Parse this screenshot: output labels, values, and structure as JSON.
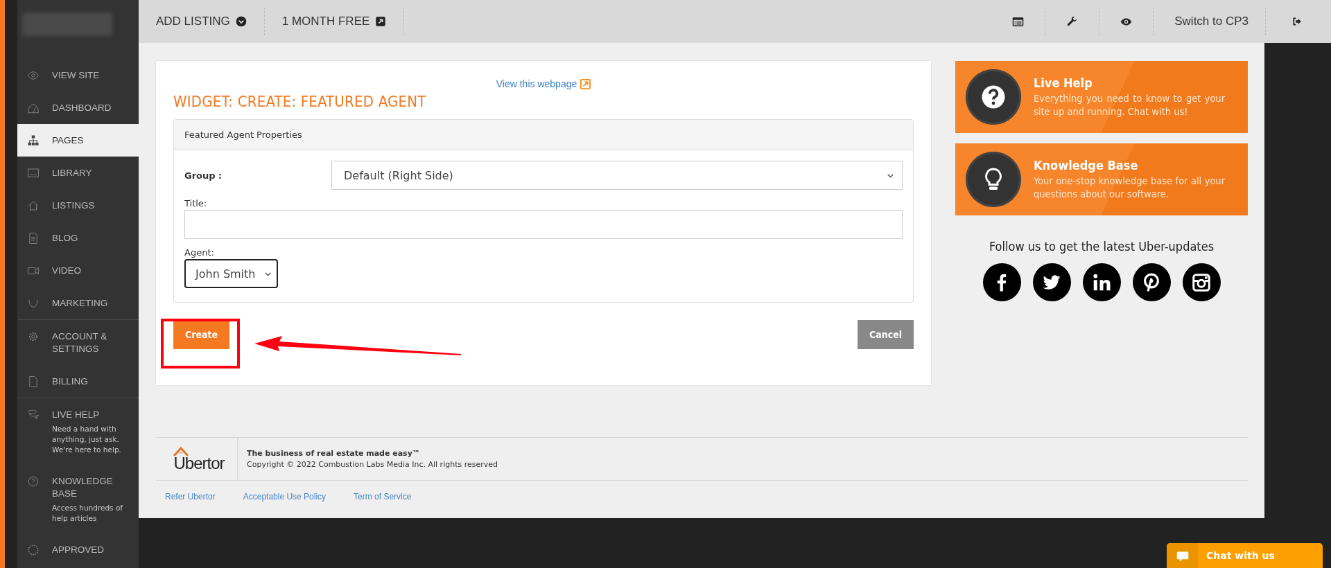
{
  "sidebar": {
    "sections": [
      {
        "items": [
          {
            "label": "VIEW SITE",
            "selected": false
          },
          {
            "label": "DASHBOARD",
            "selected": false
          },
          {
            "label": "PAGES",
            "selected": true
          },
          {
            "label": "LIBRARY",
            "selected": false
          },
          {
            "label": "LISTINGS",
            "selected": false
          },
          {
            "label": "BLOG",
            "selected": false
          },
          {
            "label": "VIDEO",
            "selected": false
          },
          {
            "label": "MARKETING",
            "selected": false
          }
        ]
      },
      {
        "items": [
          {
            "label": "ACCOUNT & SETTINGS",
            "selected": false
          },
          {
            "label": "BILLING",
            "selected": false
          }
        ]
      },
      {
        "items": [
          {
            "label": "LIVE HELP",
            "description": "Need a hand with anything, just ask. We're here to help.",
            "selected": false
          },
          {
            "label": "KNOWLEDGE BASE",
            "description": "Access hundreds of help articles",
            "selected": false
          },
          {
            "label": "APPROVED",
            "selected": false
          }
        ]
      }
    ]
  },
  "topbar": {
    "left": [
      {
        "label": "ADD LISTING",
        "kind": "dropdown"
      },
      {
        "label": "1 MONTH FREE",
        "kind": "external"
      }
    ],
    "switch_label": "Switch to CP3"
  },
  "form": {
    "link": "View this webpage",
    "title": "WIDGET: CREATE: FEATURED AGENT",
    "panel_title": "Featured Agent Properties",
    "group_label": "Group :",
    "group_value": "Default (Right Side)",
    "title_label": "Title:",
    "agent_label": "Agent:",
    "agent_value": "John Smith",
    "buttons": [
      {
        "label": "Create",
        "kind": "primary"
      },
      {
        "label": "Cancel",
        "kind": "secondary"
      }
    ]
  },
  "help_cards": [
    {
      "title": "Live Help",
      "text": "Everything you need to know to get your site up and running. Chat with us!",
      "kind": "question"
    },
    {
      "title": "Knowledge Base",
      "text": "Your one-stop knowledge base for all your questions about our software.",
      "kind": "bulb"
    }
  ],
  "follow_text": "Follow us to get the latest Uber-updates",
  "footer": {
    "logo": "Ubertor",
    "tagline": "The business of real estate made easy™",
    "copyright": "Copyright © 2022 Combustion Labs Media Inc. All rights reserved",
    "links": [
      "Refer Ubertor",
      "Acceptable Use Policy",
      "Term of Service"
    ]
  },
  "chat_button": "Chat with us"
}
